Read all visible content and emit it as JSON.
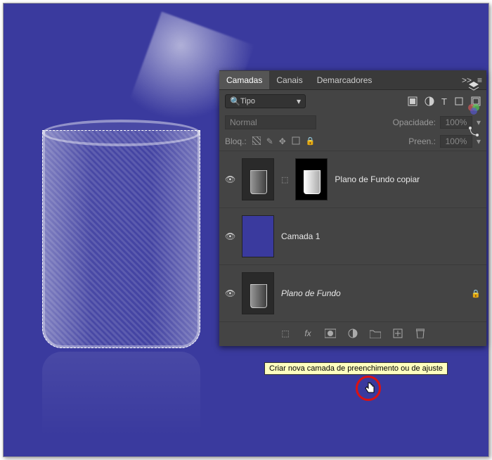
{
  "tabs": {
    "layers": "Camadas",
    "channels": "Canais",
    "paths": "Demarcadores",
    "expand": ">>"
  },
  "filter": {
    "search_placeholder": "Tipo",
    "search_icon": "🔍"
  },
  "blend": {
    "mode": "Normal",
    "opacity_label": "Opacidade:",
    "opacity_value": "100%"
  },
  "lock": {
    "label": "Bloq.:",
    "fill_label": "Preen.:",
    "fill_value": "100%"
  },
  "layers": [
    {
      "name": "Plano de Fundo copiar",
      "italic": false
    },
    {
      "name": "Camada 1",
      "italic": false
    },
    {
      "name": "Plano de Fundo",
      "italic": true,
      "locked": true
    }
  ],
  "tooltip": "Criar nova camada de preenchimento ou de ajuste"
}
